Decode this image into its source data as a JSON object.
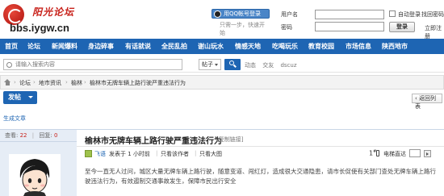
{
  "header": {
    "brand_cn": "阳光论坛",
    "domain": "bbs.iygw.cn",
    "qq_login_label": "用QQ帐号登录",
    "qq_tip": "只需一步，快速开始",
    "username_label": "用户名",
    "password_label": "密码",
    "auto_login_label": "自动登录",
    "forgot_link": "找回密码",
    "login_button": "登录",
    "register_link": "立即注册"
  },
  "nav": {
    "items": [
      "首页",
      "论坛",
      "新闻爆料",
      "身边碎事",
      "有话就说",
      "全民乱拍",
      "谢山玩水",
      "情感天地",
      "吃喝玩乐",
      "教育校园",
      "市场信息",
      "陕西地市"
    ]
  },
  "search": {
    "placeholder": "请输入搜索内容",
    "type_label": "帖子",
    "hot_terms": [
      "动态",
      "交友",
      "dscuz"
    ]
  },
  "breadcrumb": {
    "items": [
      "论坛",
      "地市资讯",
      "榆林",
      "榆林市无牌车辆上路行驶严重违法行为"
    ]
  },
  "actions": {
    "post_button": "发帖",
    "back_button": "返回列表",
    "generate_link": "生成文章"
  },
  "post": {
    "stats_views_label": "查看:",
    "stats_views": "22",
    "stats_replies_label": "回复:",
    "stats_replies": "0",
    "title": "榆林市无牌车辆上路行驶严重违法行为",
    "copy_link": "[复制链接]",
    "author": "飞语",
    "posted_at": "发表于 1 小时前",
    "only_author": "只看该作者",
    "large_image": "只看大图",
    "floor": "1",
    "floor_sup": "#",
    "direct_label": "电梯直达",
    "content": "至今一直无人过问，城区大量无牌车辆上路行驶，随意变道、闯红灯，造成很大交通隐患，请市长促使有关部门查处无牌车辆上路行驶违法行为，有效遏制交通事故发生，保障市民出行安全"
  },
  "colors": {
    "nav_bg": "#1e65b3",
    "brand_red": "#c8221b",
    "sidebar_bg": "#e6edf6"
  }
}
